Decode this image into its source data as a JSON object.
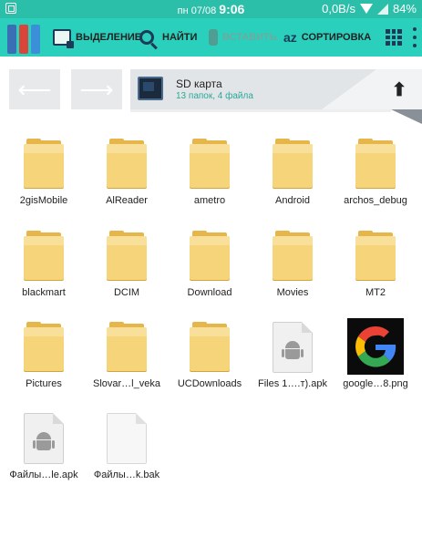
{
  "status_bar": {
    "date": "пн 07/08",
    "time": "9:06",
    "network_speed": "0,0B/s",
    "battery": "84%"
  },
  "toolbar": {
    "select_label": "ВЫДЕЛЕНИЕ",
    "search_label": "НАЙТИ",
    "paste_label": "ВСТАВИТЬ",
    "sort_glyph": "az",
    "sort_label": "СОРТИРОВКА"
  },
  "navigation": {
    "back_arrow": "⟵",
    "forward_arrow": "⟶",
    "up_arrow": "⬆"
  },
  "path": {
    "title": "SD карта",
    "subtitle": "13 папок, 4 файла"
  },
  "files": [
    {
      "name": "2gisMobile",
      "type": "folder"
    },
    {
      "name": "AlReader",
      "type": "folder"
    },
    {
      "name": "ametro",
      "type": "folder"
    },
    {
      "name": "Android",
      "type": "folder"
    },
    {
      "name": "archos_debug",
      "type": "folder"
    },
    {
      "name": "blackmart",
      "type": "folder"
    },
    {
      "name": "DCIM",
      "type": "folder"
    },
    {
      "name": "Download",
      "type": "folder"
    },
    {
      "name": "Movies",
      "type": "folder"
    },
    {
      "name": "MT2",
      "type": "folder"
    },
    {
      "name": "Pictures",
      "type": "folder"
    },
    {
      "name": "Slovar…l_veka",
      "type": "folder"
    },
    {
      "name": "UCDownloads",
      "type": "folder"
    },
    {
      "name": "Files 1….т).apk",
      "type": "apk"
    },
    {
      "name": "google…8.png",
      "type": "image"
    },
    {
      "name": "Файлы…le.apk",
      "type": "apk"
    },
    {
      "name": "Файлы…k.bak",
      "type": "bak"
    }
  ],
  "colors": {
    "status_bar": "#2bbfaa",
    "toolbar": "#2bd0bd",
    "folder": "#f6d47a",
    "subtitle": "#2aa899"
  }
}
